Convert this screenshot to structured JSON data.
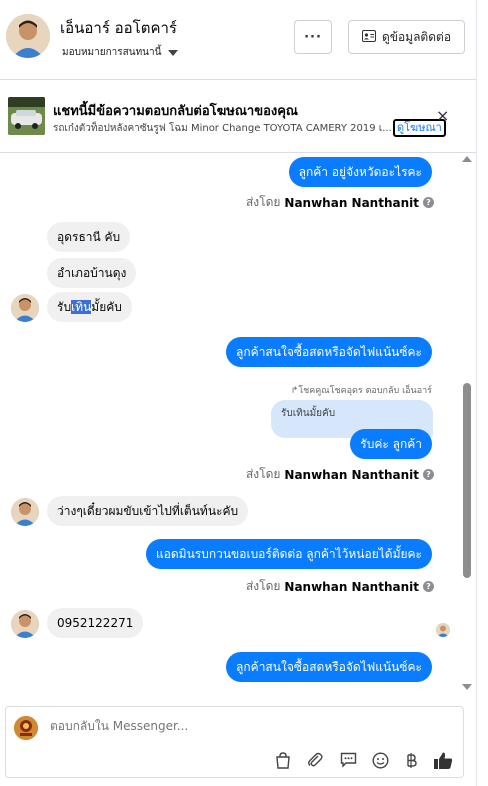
{
  "header": {
    "name": "เอ็นอาร์ ออโตคาร์",
    "assignee": "มอบหมายการสนทนานี้",
    "more_label": "···",
    "contact_label": "ดูข้อมูลติดต่อ"
  },
  "ad": {
    "title": "แชทนี้มีข้อความตอบกลับต่อโฆษณาของคุณ",
    "text": "รถเก๋งตัวท็อปหลังคาซันรูฟ โฉม Minor Change TOYOTA CAMERY 2019 เ...",
    "link_label": "ดูโฆษณา",
    "close": "×"
  },
  "messages": {
    "m1": "ลูกค้า อยู่จังหวัดอะไรคะ",
    "sent_by_prefix": "ส่งโดย",
    "sender": "Nanwhan Nanthanit",
    "m2": "อุดรธานี คับ",
    "m3": "อำเภอบ้านดุง",
    "m4_a": "รับ",
    "m4_b": "เทิน",
    "m4_c": "มั้ยคับ",
    "m5": "ลูกค้าสนใจซื้อสดหรือจัดไฟแน้นซ์คะ",
    "reply_note": "↱โชคคูณโชคอุดร ตอบกลับ เอ็นอาร์",
    "reply_quote": "รับเทินมั้ยคับ",
    "m6": "รับค่ะ ลูกค้า",
    "m7": "ว่างๆเดี๋ยวผมขับเข้าไปที่เต็นท์นะคับ",
    "m8": "แอดมินรบกวนขอเบอร์ติดต่อ ลูกค้าไว้หน่อยได้มั้ยคะ",
    "m9": "0952122271",
    "m10": "ลูกค้าสนใจซื้อสดหรือจัดไฟแน้นซ์คะ"
  },
  "composer": {
    "placeholder": "ตอบกลับใน Messenger..."
  },
  "colors": {
    "outgoing": "#0a7cff",
    "incoming": "#f0f0f0",
    "accent": "#1877f2"
  }
}
